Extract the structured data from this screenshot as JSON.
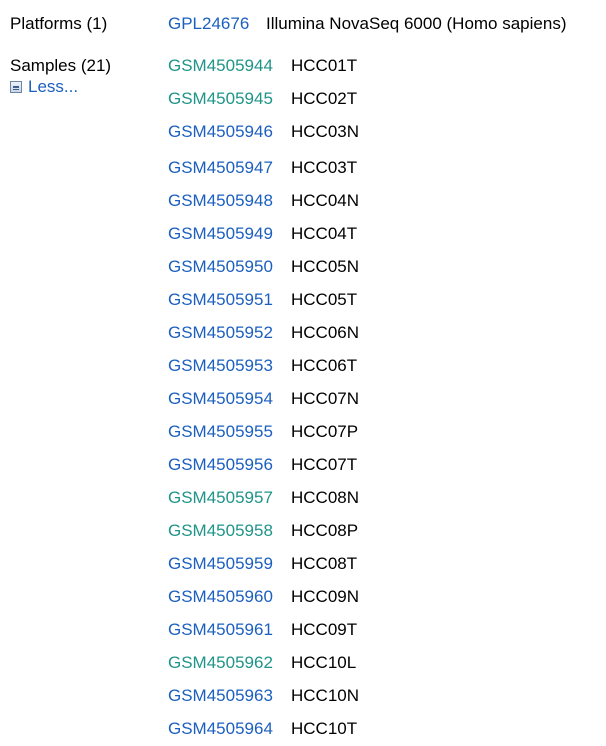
{
  "colors": {
    "link_blue": "#1b5fbf",
    "link_visited": "#1f9488",
    "text": "#000000"
  },
  "platforms": {
    "label": "Platforms (1)",
    "accession": "GPL24676",
    "description": "Illumina NovaSeq 6000 (Homo sapiens)"
  },
  "samples": {
    "label": "Samples (21)",
    "toggle_label": "Less...",
    "toggle_icon": "collapse-icon",
    "items": [
      {
        "accession": "GSM4505944",
        "title": "HCC01T",
        "visited": true
      },
      {
        "accession": "GSM4505945",
        "title": "HCC02T",
        "visited": true
      },
      {
        "accession": "GSM4505946",
        "title": "HCC03N",
        "visited": false
      },
      {
        "accession": "GSM4505947",
        "title": "HCC03T",
        "visited": false
      },
      {
        "accession": "GSM4505948",
        "title": "HCC04N",
        "visited": false
      },
      {
        "accession": "GSM4505949",
        "title": "HCC04T",
        "visited": false
      },
      {
        "accession": "GSM4505950",
        "title": "HCC05N",
        "visited": false
      },
      {
        "accession": "GSM4505951",
        "title": "HCC05T",
        "visited": false
      },
      {
        "accession": "GSM4505952",
        "title": "HCC06N",
        "visited": false
      },
      {
        "accession": "GSM4505953",
        "title": "HCC06T",
        "visited": false
      },
      {
        "accession": "GSM4505954",
        "title": "HCC07N",
        "visited": false
      },
      {
        "accession": "GSM4505955",
        "title": "HCC07P",
        "visited": false
      },
      {
        "accession": "GSM4505956",
        "title": "HCC07T",
        "visited": false
      },
      {
        "accession": "GSM4505957",
        "title": "HCC08N",
        "visited": true
      },
      {
        "accession": "GSM4505958",
        "title": "HCC08P",
        "visited": true
      },
      {
        "accession": "GSM4505959",
        "title": "HCC08T",
        "visited": false
      },
      {
        "accession": "GSM4505960",
        "title": "HCC09N",
        "visited": false
      },
      {
        "accession": "GSM4505961",
        "title": "HCC09T",
        "visited": false
      },
      {
        "accession": "GSM4505962",
        "title": "HCC10L",
        "visited": true
      },
      {
        "accession": "GSM4505963",
        "title": "HCC10N",
        "visited": false
      },
      {
        "accession": "GSM4505964",
        "title": "HCC10T",
        "visited": false
      }
    ]
  }
}
